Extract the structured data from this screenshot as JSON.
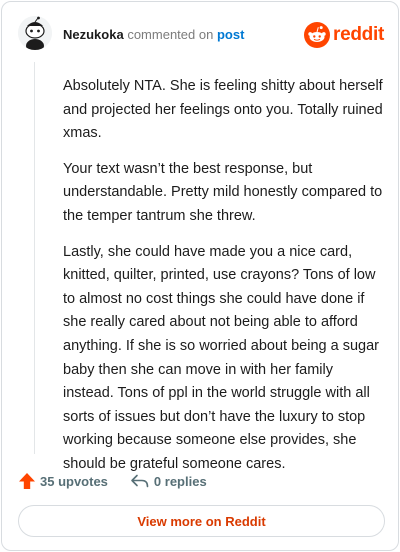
{
  "comment": {
    "author": "Nezukoka",
    "action_text": "commented on",
    "post_link": "post",
    "paragraphs": [
      "Absolutely NTA. She is feeling shitty about herself and projected her feelings onto you. Totally ruined xmas.",
      "Your text wasn’t the best response, but understandable. Pretty mild honestly compared to the temper tantrum she threw.",
      "Lastly, she could have made you a nice card, knitted, quilter, printed, use crayons? Tons of low to almost no cost things she could have done if she really cared about not being able to afford anything. If she is so worried about being a sugar baby then she can move in with her family instead. Tons of ppl in the world struggle with all sorts of issues but don’t have the luxury to stop working because someone else provides, she should be grateful someone cares."
    ]
  },
  "brand": {
    "wordmark": "reddit",
    "color": "#ff4500",
    "icon": "reddit-logo-icon"
  },
  "actions": {
    "upvotes": "35 upvotes",
    "replies": "0 replies",
    "upvote_icon": "upvote-arrow-icon",
    "reply_icon": "reply-arrow-icon",
    "upvote_color": "#ff4500"
  },
  "footer": {
    "view_more": "View more on Reddit"
  }
}
